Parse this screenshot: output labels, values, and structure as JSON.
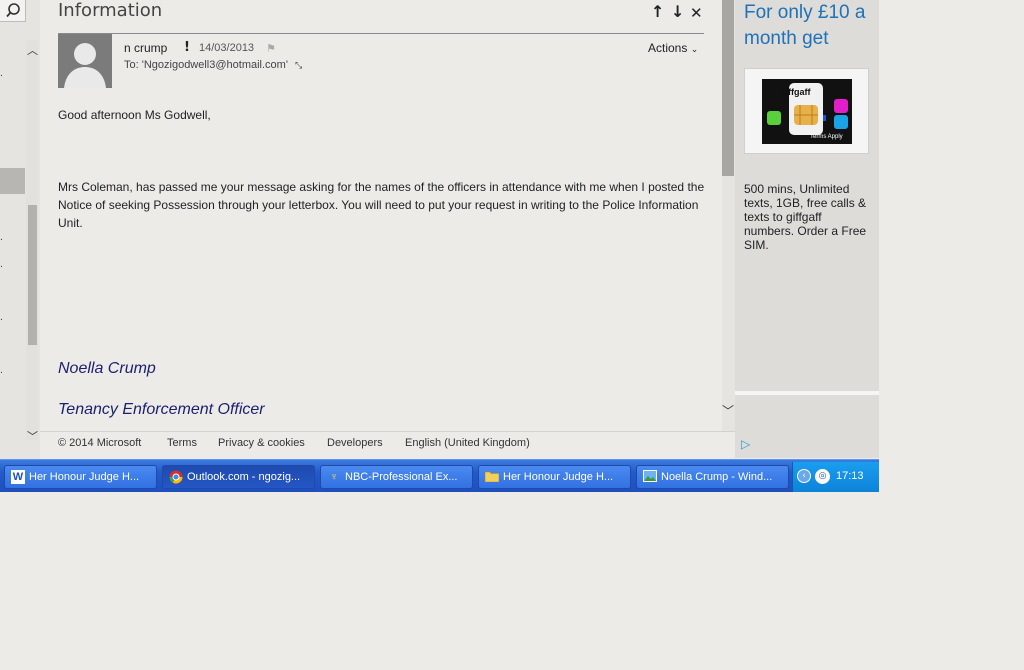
{
  "window": {
    "pane_title": "Information"
  },
  "message": {
    "sender": "n crump",
    "importance_mark": "!",
    "date": "14/03/2013",
    "to": "To: 'Ngozigodwell3@hotmail.com'",
    "actions_label": "Actions",
    "greeting": "Good afternoon Ms Godwell,",
    "body": "Mrs Coleman, has passed me your message asking for the names of the officers in attendance with me when I posted the Notice of seeking Possession through your letterbox. You will need to put your request in writing to the Police Information Unit.",
    "signature_name": "Noella Crump",
    "signature_title": "Tenancy Enforcement Officer"
  },
  "ad": {
    "headline": "For only £10 a month get",
    "brand": "giffgaff",
    "terms": "Terms Apply",
    "description": "500 mins, Unlimited texts, 1GB, free calls & texts to giffgaff numbers. Order a Free SIM."
  },
  "footer": {
    "copyright": "© 2014 Microsoft",
    "terms": "Terms",
    "privacy": "Privacy & cookies",
    "developers": "Developers",
    "language": "English (United Kingdom)"
  },
  "taskbar": {
    "items": [
      {
        "label": "Her Honour Judge H...",
        "icon": "word-document-icon"
      },
      {
        "label": "Outlook.com - ngozig...",
        "icon": "chrome-icon"
      },
      {
        "label": "NBC-Professional Ex...",
        "icon": "application-icon"
      },
      {
        "label": "Her Honour Judge H...",
        "icon": "folder-icon"
      },
      {
        "label": "Noella Crump - Wind...",
        "icon": "image-viewer-icon"
      }
    ],
    "clock": "17:13"
  }
}
